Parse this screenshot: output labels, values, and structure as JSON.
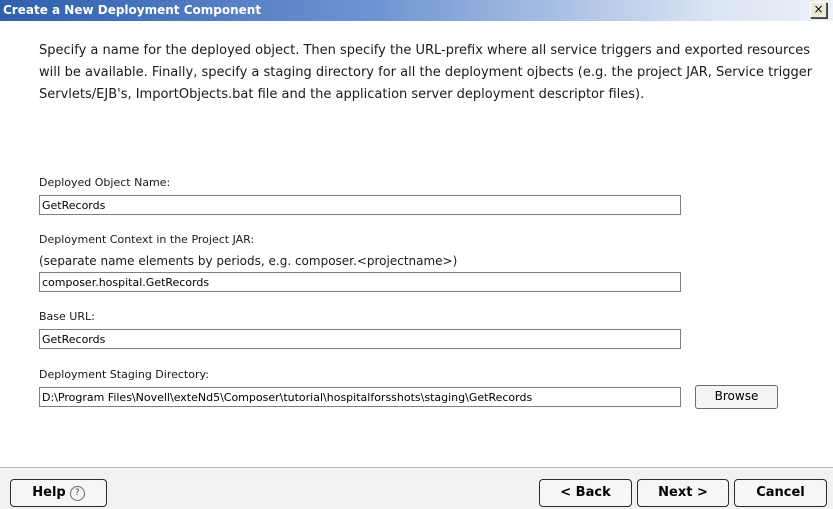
{
  "window": {
    "title": "Create a New Deployment Component",
    "close_glyph": "×"
  },
  "description": "Specify a name for the deployed object.  Then specify the URL-prefix where all service triggers and exported resources will be available.  Finally, specify a staging directory for all the deployment ojbects (e.g. the project JAR, Service trigger Servlets/EJB's, ImportObjects.bat file and the application server deployment descriptor files).",
  "fields": {
    "object_name": {
      "label": "Deployed Object Name:",
      "value": "GetRecords"
    },
    "context": {
      "label": "Deployment Context in the Project JAR:",
      "hint": "(separate name elements by periods, e.g. composer.<projectname>)",
      "value": "composer.hospital.GetRecords"
    },
    "base_url": {
      "label": "Base URL:",
      "value": "GetRecords"
    },
    "staging_dir": {
      "label": "Deployment Staging Directory:",
      "value": "D:\\Program Files\\Novell\\exteNd5\\Composer\\tutorial\\hospitalforsshots\\staging\\GetRecords",
      "browse_label": "Browse"
    }
  },
  "buttons": {
    "help": "Help",
    "help_icon": "?",
    "back": "< Back",
    "next": "Next >",
    "cancel": "Cancel"
  }
}
